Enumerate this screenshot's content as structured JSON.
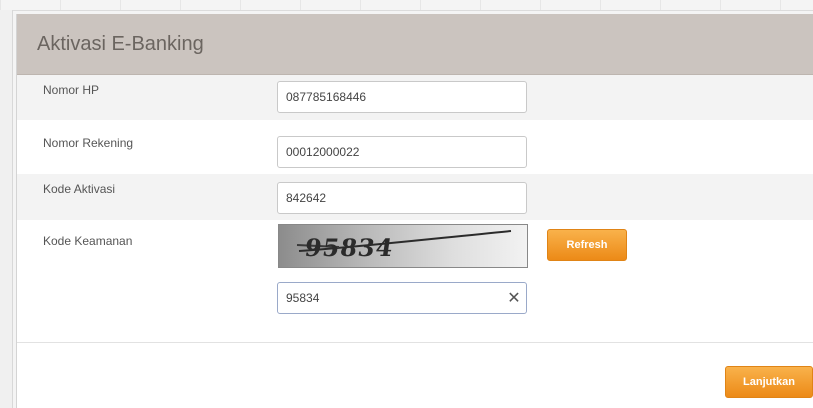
{
  "panel": {
    "title": "Aktivasi E-Banking"
  },
  "form": {
    "rows": [
      {
        "label": "Nomor HP",
        "value": "087785168446"
      },
      {
        "label": "Nomor Rekening",
        "value": "00012000022"
      },
      {
        "label": "Kode Aktivasi",
        "value": "842642"
      },
      {
        "label": "Kode Keamanan",
        "captcha_text": "95834",
        "value": "95834"
      }
    ]
  },
  "buttons": {
    "refresh_label": "Refresh",
    "submit_label": "Lanjutkan"
  },
  "icons": {
    "clear": "close-icon"
  },
  "colors": {
    "header_bg": "#cbc4bf",
    "accent_orange": "#ec8a17",
    "row_shade": "#f3f3f3"
  }
}
